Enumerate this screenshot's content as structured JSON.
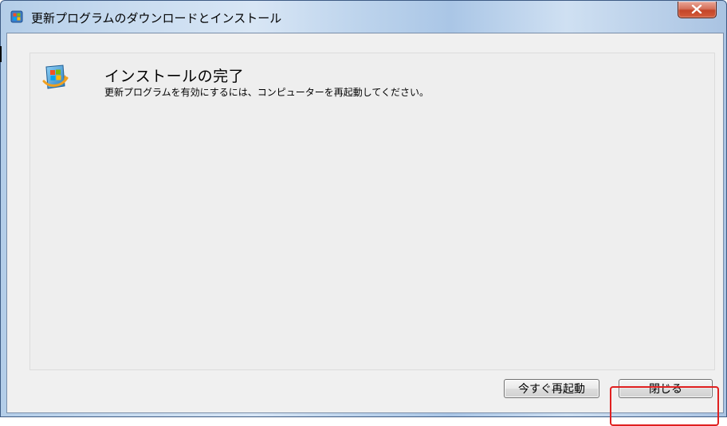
{
  "window": {
    "title": "更新プログラムのダウンロードとインストール",
    "title_icon": "windows-update-icon",
    "close_glyph": "X"
  },
  "content": {
    "status_icon": "windows-update-icon",
    "heading": "インストールの完了",
    "message": "更新プログラムを有効にするには、コンピューターを再起動してください。"
  },
  "buttons": {
    "restart_now": "今すぐ再起動",
    "close": "閉じる"
  },
  "colors": {
    "close_button": "#c44529",
    "highlight": "#e02020"
  }
}
